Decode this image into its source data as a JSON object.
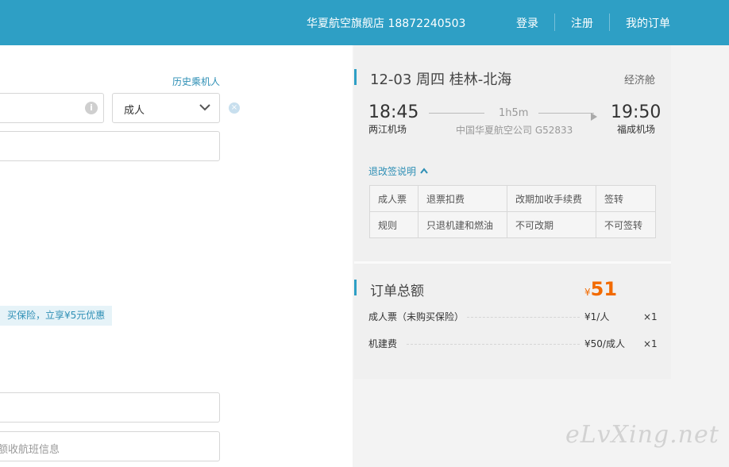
{
  "header": {
    "shop_name": "华夏航空旗舰店 18872240503",
    "login": "登录",
    "register": "注册",
    "my_orders": "我的订单"
  },
  "passenger_form": {
    "history_link": "历史乘机人",
    "info_icon": "i",
    "type_select": "成人",
    "insurance_promo": "买保险，立享¥5元优惠",
    "flight_info_placeholder": "额收航班信息"
  },
  "flight": {
    "date_route": "12-03 周四   桂林-北海",
    "cabin": "经济舱",
    "depart_time": "18:45",
    "depart_airport": "两江机场",
    "duration": "1h5m",
    "airline": "中国华夏航空公司 G52833",
    "arrive_time": "19:50",
    "arrive_airport": "福成机场",
    "refund_link": "退改签说明"
  },
  "rules_table": {
    "rows": [
      [
        "成人票",
        "退票扣费",
        "改期加收手续费",
        "签转"
      ],
      [
        "规则",
        "只退机建和燃油",
        "不可改期",
        "不可签转"
      ]
    ]
  },
  "order_total": {
    "title": "订单总额",
    "currency": "¥",
    "amount": "51",
    "items": [
      {
        "label": "成人票（未购买保险）",
        "price": "¥1/人",
        "qty": "×1"
      },
      {
        "label": "机建费",
        "price": "¥50/成人",
        "qty": "×1"
      }
    ]
  },
  "watermark": "eLvXing.net",
  "colors": {
    "brand": "#2e9fc5",
    "price": "#f26a00",
    "link": "#2e8fb5"
  }
}
